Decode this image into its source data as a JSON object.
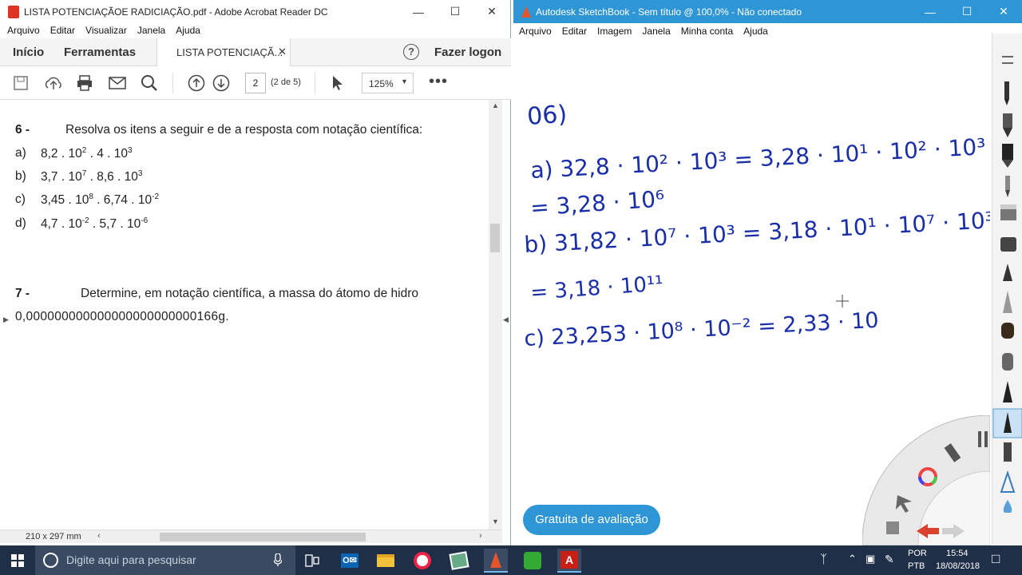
{
  "acrobat": {
    "title": "LISTA POTENCIAÇÃOE  RADICIAÇÃO.pdf - Adobe Acrobat Reader DC",
    "menu": [
      "Arquivo",
      "Editar",
      "Visualizar",
      "Janela",
      "Ajuda"
    ],
    "tabs": {
      "home": "Início",
      "tools": "Ferramentas",
      "doc_tab": "LISTA POTENCIAÇÃ...",
      "login": "Fazer logon"
    },
    "toolbar": {
      "page_value": "2",
      "page_count": "(2 de 5)",
      "zoom": "125%"
    },
    "document": {
      "q6_num": "6 -",
      "q6_text": "Resolva os itens a seguir e de a resposta com notação científica:",
      "items": [
        {
          "label": "a)",
          "parts": [
            "8,2 . 10",
            "2",
            " . 4 . 10",
            "3"
          ]
        },
        {
          "label": "b)",
          "parts": [
            "3,7 . 10",
            "7",
            " . 8,6 . 10",
            "3"
          ]
        },
        {
          "label": "c)",
          "parts": [
            "3,45 . 10",
            "8",
            " . 6,74 . 10",
            "-2"
          ]
        },
        {
          "label": "d)",
          "parts": [
            "4,7 . 10",
            "-2",
            " . 5,7 . 10",
            "-6"
          ]
        }
      ],
      "q7_num": "7 -",
      "q7_text": "Determine, em notação científica, a massa do átomo de hidro",
      "q7_value": "0,000000000000000000000000166g."
    },
    "status": {
      "page_size": "210 x 297 mm"
    }
  },
  "sketchbook": {
    "title": "Autodesk SketchBook - Sem título @ 100,0% - Não conectado",
    "menu": [
      "Arquivo",
      "Editar",
      "Imagem",
      "Janela",
      "Minha conta",
      "Ajuda"
    ],
    "trial_button": "Gratuita de avaliação",
    "handwriting": {
      "header": "06)",
      "line_a": "a) 32,8 · 10² · 10³ = 3,28 · 10¹ · 10² · 10³",
      "line_a2": "= 3,28 · 10⁶",
      "line_b": "b) 31,82 · 10⁷ · 10³ = 3,18 · 10¹ · 10⁷ · 10³",
      "line_b2": "= 3,18 · 10¹¹",
      "line_c": "c) 23,253 · 10⁸ · 10⁻² = 2,33 · 10"
    }
  },
  "taskbar": {
    "search_placeholder": "Digite aqui para pesquisar",
    "lang1": "POR",
    "lang2": "PTB",
    "time": "15:54",
    "date": "18/08/2018"
  }
}
